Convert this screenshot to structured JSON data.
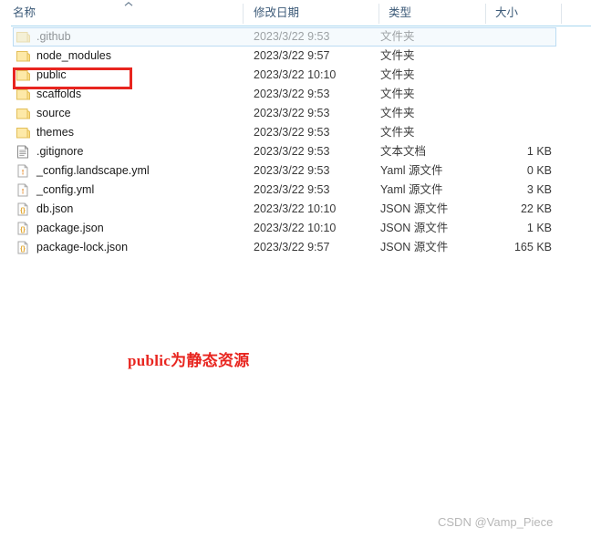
{
  "columns": {
    "name": "名称",
    "date": "修改日期",
    "type": "类型",
    "size": "大小",
    "sort_icon": "chevron-up-icon"
  },
  "rows": [
    {
      "name": ".github",
      "date": "2023/3/22 9:53",
      "type": "文件夹",
      "size": "",
      "icon": "folder-icon",
      "selected": true
    },
    {
      "name": "node_modules",
      "date": "2023/3/22 9:57",
      "type": "文件夹",
      "size": "",
      "icon": "folder-icon",
      "selected": false
    },
    {
      "name": "public",
      "date": "2023/3/22 10:10",
      "type": "文件夹",
      "size": "",
      "icon": "folder-icon",
      "selected": false
    },
    {
      "name": "scaffolds",
      "date": "2023/3/22 9:53",
      "type": "文件夹",
      "size": "",
      "icon": "folder-icon",
      "selected": false
    },
    {
      "name": "source",
      "date": "2023/3/22 9:53",
      "type": "文件夹",
      "size": "",
      "icon": "folder-icon",
      "selected": false
    },
    {
      "name": "themes",
      "date": "2023/3/22 9:53",
      "type": "文件夹",
      "size": "",
      "icon": "folder-icon",
      "selected": false
    },
    {
      "name": ".gitignore",
      "date": "2023/3/22 9:53",
      "type": "文本文档",
      "size": "1 KB",
      "icon": "text-document-icon",
      "selected": false
    },
    {
      "name": "_config.landscape.yml",
      "date": "2023/3/22 9:53",
      "type": "Yaml 源文件",
      "size": "0 KB",
      "icon": "yaml-file-icon",
      "selected": false
    },
    {
      "name": "_config.yml",
      "date": "2023/3/22 9:53",
      "type": "Yaml 源文件",
      "size": "3 KB",
      "icon": "yaml-file-icon",
      "selected": false
    },
    {
      "name": "db.json",
      "date": "2023/3/22 10:10",
      "type": "JSON 源文件",
      "size": "22 KB",
      "icon": "json-file-icon",
      "selected": false
    },
    {
      "name": "package.json",
      "date": "2023/3/22 10:10",
      "type": "JSON 源文件",
      "size": "1 KB",
      "icon": "json-file-icon",
      "selected": false
    },
    {
      "name": "package-lock.json",
      "date": "2023/3/22 9:57",
      "type": "JSON 源文件",
      "size": "165 KB",
      "icon": "json-file-icon",
      "selected": false
    }
  ],
  "annotation": {
    "caption": "public为静态资源",
    "highlight_target": "public",
    "color": "#e8251f"
  },
  "watermark": {
    "text": "CSDN @Vamp_Piece"
  }
}
